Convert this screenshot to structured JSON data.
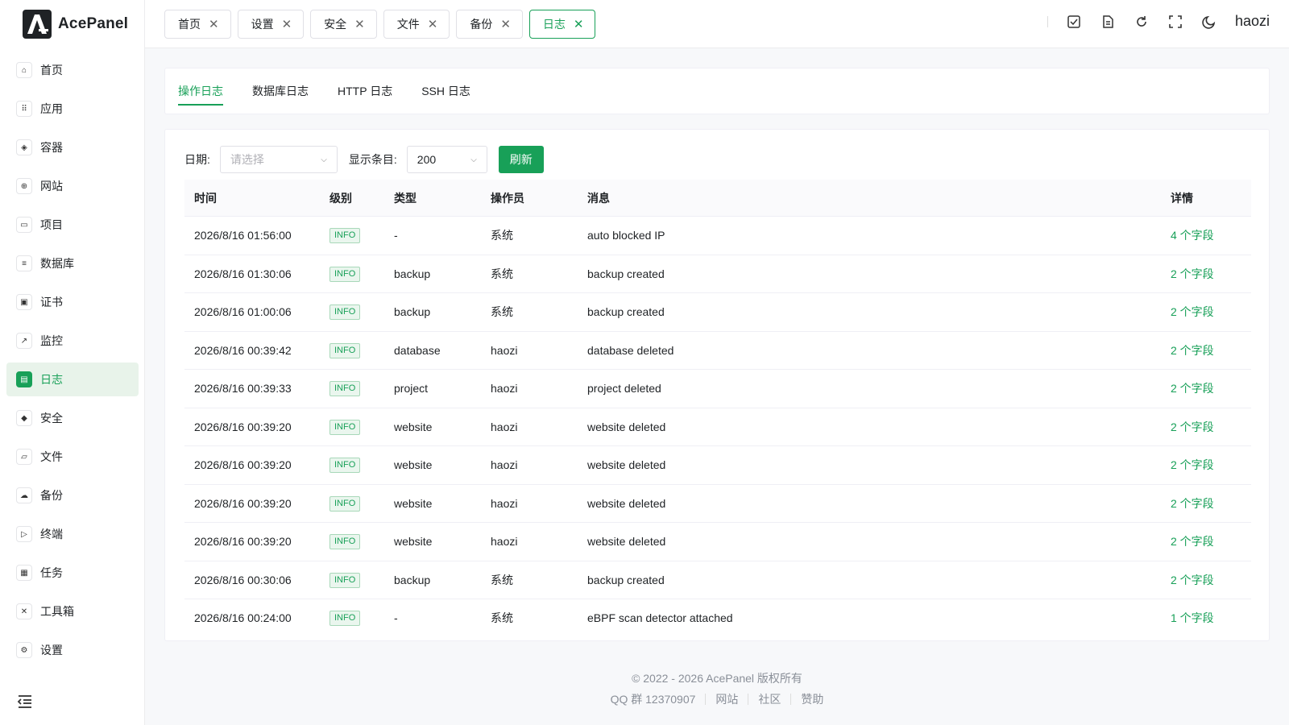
{
  "app": {
    "name": "AcePanel"
  },
  "sidebar": {
    "items": [
      {
        "label": "首页",
        "icon": "home-icon",
        "glyph": "⌂"
      },
      {
        "label": "应用",
        "icon": "apps-grid-icon",
        "glyph": "⠿"
      },
      {
        "label": "容器",
        "icon": "layers-icon",
        "glyph": "◈"
      },
      {
        "label": "网站",
        "icon": "globe-icon",
        "glyph": "⊕"
      },
      {
        "label": "项目",
        "icon": "folders-icon",
        "glyph": "▭"
      },
      {
        "label": "数据库",
        "icon": "database-icon",
        "glyph": "≡"
      },
      {
        "label": "证书",
        "icon": "certificate-icon",
        "glyph": "▣"
      },
      {
        "label": "监控",
        "icon": "chart-icon",
        "glyph": "↗"
      },
      {
        "label": "日志",
        "icon": "log-file-icon",
        "glyph": "▤",
        "active": true
      },
      {
        "label": "安全",
        "icon": "shield-icon",
        "glyph": "◆"
      },
      {
        "label": "文件",
        "icon": "folder-icon",
        "glyph": "▱"
      },
      {
        "label": "备份",
        "icon": "cloud-backup-icon",
        "glyph": "☁"
      },
      {
        "label": "终端",
        "icon": "terminal-icon",
        "glyph": "▷"
      },
      {
        "label": "任务",
        "icon": "tasks-icon",
        "glyph": "▦"
      },
      {
        "label": "工具箱",
        "icon": "tools-icon",
        "glyph": "✕"
      },
      {
        "label": "设置",
        "icon": "settings-icon",
        "glyph": "⚙"
      }
    ]
  },
  "header": {
    "tabs": [
      {
        "label": "首页"
      },
      {
        "label": "设置"
      },
      {
        "label": "安全"
      },
      {
        "label": "文件"
      },
      {
        "label": "备份"
      },
      {
        "label": "日志",
        "active": true
      }
    ],
    "close_glyph": "✕",
    "username": "haozi"
  },
  "subtabs": [
    {
      "label": "操作日志",
      "active": true
    },
    {
      "label": "数据库日志"
    },
    {
      "label": "HTTP 日志"
    },
    {
      "label": "SSH 日志"
    }
  ],
  "filters": {
    "date_label": "日期:",
    "date_placeholder": "请选择",
    "count_label": "显示条目:",
    "count_value": "200",
    "refresh_label": "刷新"
  },
  "table": {
    "columns": [
      "时间",
      "级别",
      "类型",
      "操作员",
      "消息",
      "详情"
    ],
    "rows": [
      [
        "2026/8/16 01:56:00",
        "INFO",
        "-",
        "系统",
        "auto blocked IP",
        "4 个字段"
      ],
      [
        "2026/8/16 01:30:06",
        "INFO",
        "backup",
        "系统",
        "backup created",
        "2 个字段"
      ],
      [
        "2026/8/16 01:00:06",
        "INFO",
        "backup",
        "系统",
        "backup created",
        "2 个字段"
      ],
      [
        "2026/8/16 00:39:42",
        "INFO",
        "database",
        "haozi",
        "database deleted",
        "2 个字段"
      ],
      [
        "2026/8/16 00:39:33",
        "INFO",
        "project",
        "haozi",
        "project deleted",
        "2 个字段"
      ],
      [
        "2026/8/16 00:39:20",
        "INFO",
        "website",
        "haozi",
        "website deleted",
        "2 个字段"
      ],
      [
        "2026/8/16 00:39:20",
        "INFO",
        "website",
        "haozi",
        "website deleted",
        "2 个字段"
      ],
      [
        "2026/8/16 00:39:20",
        "INFO",
        "website",
        "haozi",
        "website deleted",
        "2 个字段"
      ],
      [
        "2026/8/16 00:39:20",
        "INFO",
        "website",
        "haozi",
        "website deleted",
        "2 个字段"
      ],
      [
        "2026/8/16 00:30:06",
        "INFO",
        "backup",
        "系统",
        "backup created",
        "2 个字段"
      ],
      [
        "2026/8/16 00:24:00",
        "INFO",
        "-",
        "系统",
        "eBPF scan detector attached",
        "1 个字段"
      ]
    ]
  },
  "footer": {
    "copyright": "© 2022 - 2026 AcePanel 版权所有",
    "qq": "QQ 群 12370907",
    "links": [
      "网站",
      "社区",
      "赞助"
    ]
  },
  "colors": {
    "accent": "#18a058",
    "accent_bg": "#e8f3ea"
  }
}
